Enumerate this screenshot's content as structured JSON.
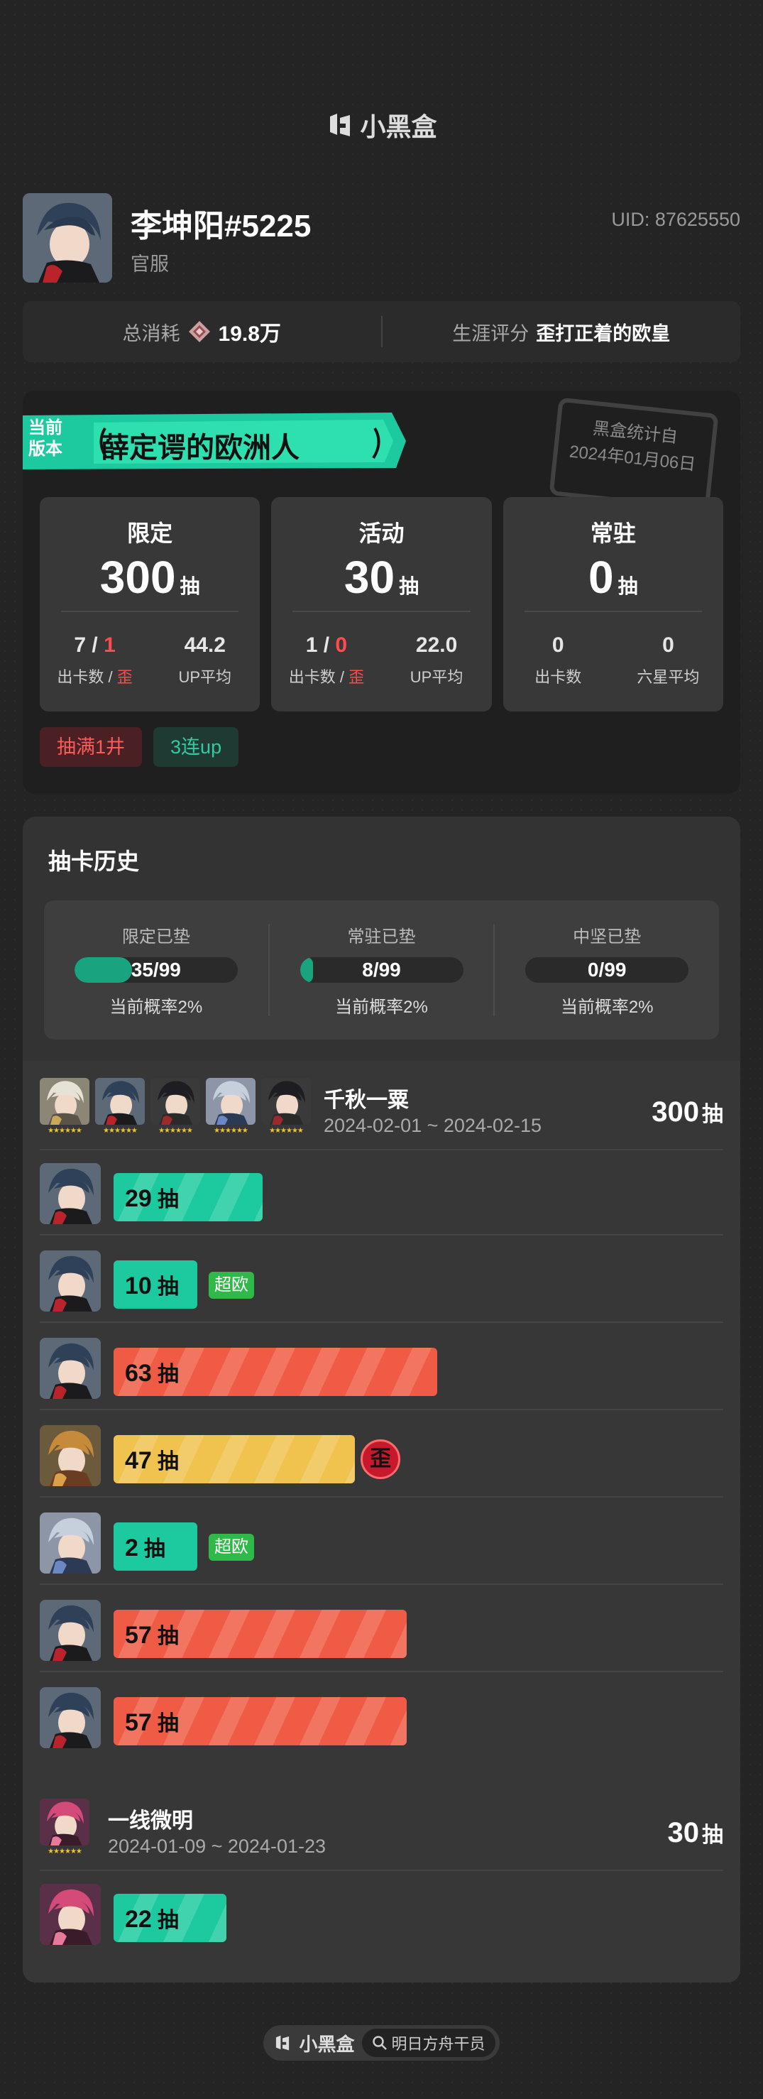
{
  "brand": {
    "name": "小黑盒"
  },
  "profile": {
    "name": "李坤阳#5225",
    "server": "官服",
    "uid": "UID: 87625550"
  },
  "stats": {
    "spend_label": "总消耗",
    "spend_value": "19.8万",
    "rating_label": "生涯评分",
    "rating_value": "歪打正着的欧皇"
  },
  "season": {
    "tag_line1": "当前",
    "tag_line2": "版本",
    "title": "薛定谔的欧洲人",
    "stamp_line1": "黑盒统计自",
    "stamp_line2": "2024年01月06日",
    "cards": [
      {
        "title": "限定",
        "count": "300",
        "unit": "抽",
        "v1a": "7",
        "v1b": "1",
        "l1a": "出卡数",
        "l1b": "歪",
        "v2": "44.2",
        "l2": "UP平均"
      },
      {
        "title": "活动",
        "count": "30",
        "unit": "抽",
        "v1a": "1",
        "v1b": "0",
        "l1a": "出卡数",
        "l1b": "歪",
        "v2": "22.0",
        "l2": "UP平均"
      },
      {
        "title": "常驻",
        "count": "0",
        "unit": "抽",
        "v1": "0",
        "l1": "出卡数",
        "v2": "0",
        "l2": "六星平均"
      }
    ],
    "tags": [
      "抽满1井",
      "3连up"
    ]
  },
  "history": {
    "title": "抽卡历史",
    "pity": [
      {
        "label": "限定已垫",
        "value": "35/99",
        "fill": 0.354,
        "prob": "当前概率2%"
      },
      {
        "label": "常驻已垫",
        "value": "8/99",
        "fill": 0.081,
        "prob": "当前概率2%"
      },
      {
        "label": "中坚已垫",
        "value": "0/99",
        "fill": 0.0,
        "prob": "当前概率2%"
      }
    ],
    "banners": [
      {
        "name": "千秋一粟",
        "date": "2024-02-01 ~ 2024-02-15",
        "total": "300",
        "unit": "抽",
        "stars": "★★★★★★",
        "pulls": [
          {
            "count": "29",
            "unit": "抽",
            "color": "green",
            "badge": ""
          },
          {
            "count": "10",
            "unit": "抽",
            "color": "green",
            "badge": "超欧"
          },
          {
            "count": "63",
            "unit": "抽",
            "color": "red",
            "badge": ""
          },
          {
            "count": "47",
            "unit": "抽",
            "color": "yellow",
            "badge": "",
            "off_banner": "歪"
          },
          {
            "count": "2",
            "unit": "抽",
            "color": "green",
            "badge": "超欧"
          },
          {
            "count": "57",
            "unit": "抽",
            "color": "red",
            "badge": ""
          },
          {
            "count": "57",
            "unit": "抽",
            "color": "red",
            "badge": ""
          }
        ]
      },
      {
        "name": "一线微明",
        "date": "2024-01-09 ~ 2024-01-23",
        "total": "30",
        "unit": "抽",
        "stars": "★★★★★★",
        "pulls": [
          {
            "count": "22",
            "unit": "抽",
            "color": "green",
            "badge": ""
          }
        ]
      }
    ]
  },
  "footer": {
    "brand": "小黑盒",
    "search": "明日方舟干员"
  },
  "colors": {
    "green": "#1dc99e",
    "red": "#ef5b44",
    "yellow": "#f0c24e",
    "accent_red": "#ff4b4b",
    "badge_green": "#2fb948"
  }
}
